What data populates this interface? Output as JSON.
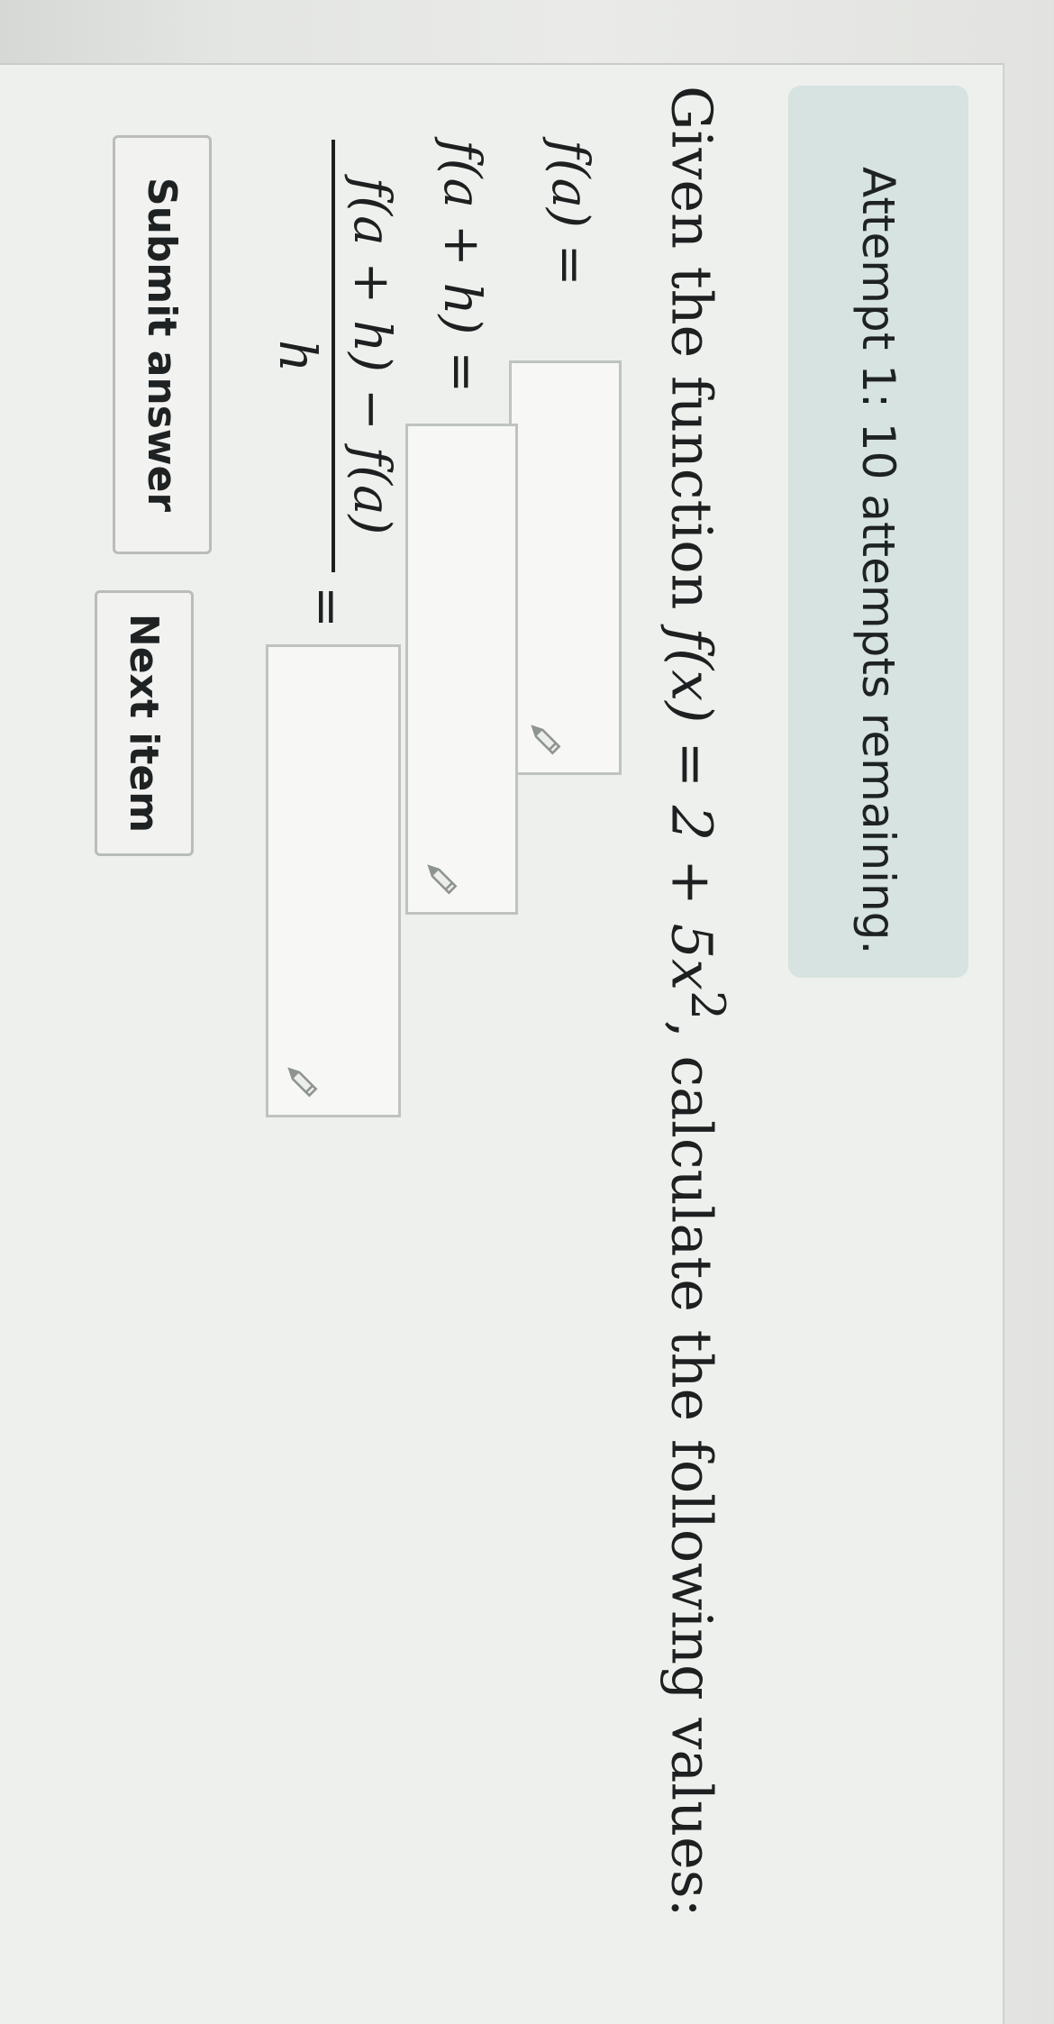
{
  "attempt": {
    "text": "Attempt 1: 10 attempts remaining."
  },
  "question": {
    "intro": "Given the function ",
    "function": "f(x) = 2 + 5x",
    "exponent": "2",
    "outro": ", calculate the following values:"
  },
  "rows": [
    {
      "label": "f(a) =",
      "value": ""
    },
    {
      "label": "f(a + h) =",
      "value": ""
    },
    {
      "numerator": "f(a + h) − f(a)",
      "denominator": "h",
      "equals": "=",
      "value": ""
    }
  ],
  "buttons": {
    "submit": "Submit answer",
    "next": "Next item"
  },
  "icons": {
    "input_tool": "pencil-icon"
  },
  "colors": {
    "banner": "#d6e3e0",
    "text": "#1d1f20",
    "border": "#bfc3be"
  }
}
